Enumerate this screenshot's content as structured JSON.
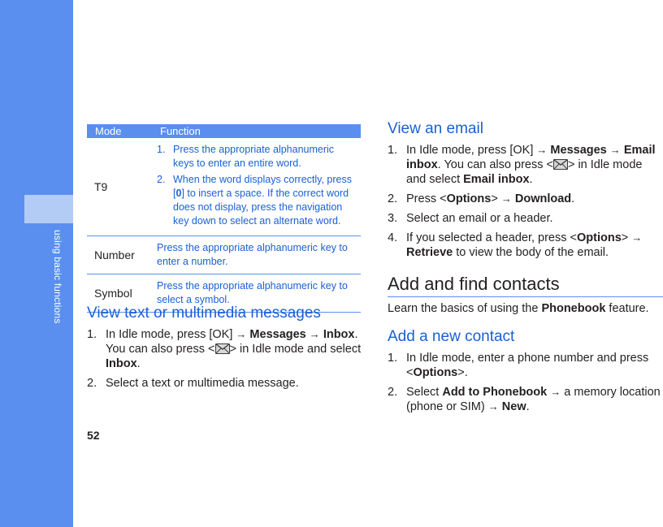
{
  "sidebar": {
    "label": "using basic functions"
  },
  "page_number": "52",
  "table": {
    "headers": {
      "mode": "Mode",
      "function": "Function"
    },
    "t9": {
      "mode": "T9",
      "step1_num": "1.",
      "step1": "Press the appropriate alphanumeric keys to enter an entire word.",
      "step2_num": "2.",
      "step2_a": "When the word displays correctly, press [",
      "step2_key": "0",
      "step2_b": "] to insert a space. If the correct word does not display, press the navigation key down to select an alternate word."
    },
    "number": {
      "mode": "Number",
      "function": "Press the appropriate alphanumeric key to enter a number."
    },
    "symbol": {
      "mode": "Symbol",
      "function": "Press the appropriate alphanumeric key to select a symbol."
    }
  },
  "view_messages": {
    "title": "View text or multimedia messages",
    "step1_num": "1.",
    "s1_a": "In Idle mode, press [",
    "s1_ok": "OK",
    "s1_b": "] ",
    "arrow": "→",
    "s1_messages": "Messages",
    "s1_inbox": "Inbox",
    "s1_c": ". You can also press <",
    "s1_d": "> in Idle mode and select ",
    "s1_inbox2": "Inbox",
    "s1_e": ".",
    "step2_num": "2.",
    "step2": "Select a text or multimedia message."
  },
  "view_email": {
    "title": "View an email",
    "step1_num": "1.",
    "s1_a": "In Idle mode, press [",
    "s1_ok": "OK",
    "s1_b": "] ",
    "arrow": "→",
    "s1_messages": "Messages",
    "s1_email_inbox": "Email inbox",
    "s1_c": ". You can also press <",
    "s1_d": "> in Idle mode and select ",
    "s1_email_inbox2": "Email inbox",
    "s1_e": ".",
    "step2_num": "2.",
    "s2_a": "Press <",
    "s2_options": "Options",
    "s2_b": "> ",
    "s2_download": "Download",
    "s2_c": ".",
    "step3_num": "3.",
    "step3": "Select an email or a header.",
    "step4_num": "4.",
    "s4_a": "If you selected a header, press <",
    "s4_options": "Options",
    "s4_b": "> ",
    "s4_retrieve": "Retrieve",
    "s4_c": " to view the body of the email."
  },
  "contacts": {
    "title": "Add and find contacts",
    "intro_a": "Learn the basics of using the ",
    "intro_phonebook": "Phonebook",
    "intro_b": " feature."
  },
  "add_contact": {
    "title": "Add a new contact",
    "step1_num": "1.",
    "s1_a": "In Idle mode, enter a phone number and press <",
    "s1_options": "Options",
    "s1_b": ">.",
    "step2_num": "2.",
    "s2_a": "Select ",
    "s2_add": "Add to Phonebook",
    "arrow": "→",
    "s2_b": " a memory location (phone or SIM) ",
    "s2_new": "New",
    "s2_c": "."
  },
  "icons": {
    "message_key": "envelope-icon"
  },
  "colors": {
    "sidebar": "#5a8ff0",
    "sidebar_tab": "#b3ccf5",
    "heading_blue": "#1a5fd6"
  }
}
